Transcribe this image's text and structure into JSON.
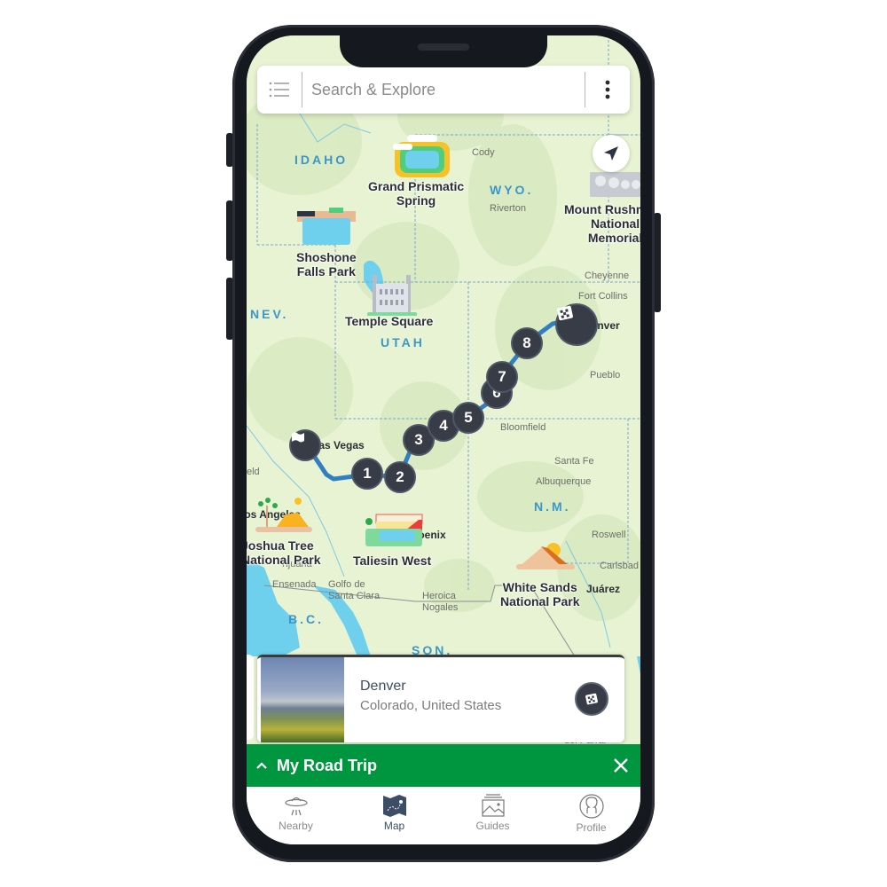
{
  "search": {
    "placeholder": "Search & Explore"
  },
  "map": {
    "state_labels": [
      "IDAHO",
      "WYO.",
      "NEV.",
      "UTAH",
      "N.M.",
      "B.C.",
      "SON."
    ],
    "city_labels": [
      "Cody",
      "Riverton",
      "Cheyenne",
      "Fort Collins",
      "Pueblo",
      "Bloomfield",
      "Santa Fe",
      "Albuquerque",
      "Roswell",
      "Carlsbad",
      "Ensenada",
      "Golfo de Santa Clara",
      "Heroica Nogales",
      "Tijuana",
      "Juárez",
      "del Parral",
      "eld"
    ],
    "dark_city_labels": [
      "Las Vegas",
      "Denver",
      "Phoenix",
      "Los Angeles"
    ],
    "points_of_interest": [
      {
        "name": "Grand Prismatic Spring",
        "line1": "Grand Prismatic",
        "line2": "Spring"
      },
      {
        "name": "Mount Rushmore National Memorial",
        "line1": "Mount Rushmore",
        "line2": "National",
        "line3": "Memorial"
      },
      {
        "name": "Shoshone Falls Park",
        "line1": "Shoshone",
        "line2": "Falls Park"
      },
      {
        "name": "Temple Square",
        "line1": "Temple Square"
      },
      {
        "name": "Joshua Tree National Park",
        "line1": "Joshua Tree",
        "line2": "National Park"
      },
      {
        "name": "Taliesin West",
        "line1": "Taliesin West"
      },
      {
        "name": "White Sands National Park",
        "line1": "White Sands",
        "line2": "National Park"
      }
    ],
    "route": {
      "start": "Las Vegas",
      "end": "Denver",
      "stops": [
        "1",
        "2",
        "3",
        "4",
        "5",
        "6",
        "7",
        "8"
      ],
      "route_color": "#2f7fc1",
      "marker_color": "#373c47"
    }
  },
  "card": {
    "title": "Denver",
    "subtitle": "Colorado, United States"
  },
  "trip_bar": {
    "title": "My Road Trip",
    "color": "#00963f"
  },
  "tabs": [
    {
      "label": "Nearby",
      "icon": "ufo-icon",
      "active": false
    },
    {
      "label": "Map",
      "icon": "map-icon",
      "active": true
    },
    {
      "label": "Guides",
      "icon": "guides-icon",
      "active": false
    },
    {
      "label": "Profile",
      "icon": "profile-icon",
      "active": false
    }
  ]
}
